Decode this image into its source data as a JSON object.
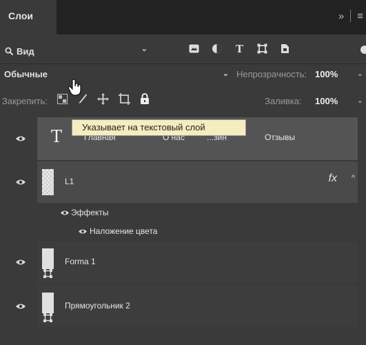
{
  "tabs": {
    "active_label": "Слои",
    "collapse_symbol": "»",
    "menu_symbol": "≡"
  },
  "filter": {
    "label": "Вид",
    "icons": [
      "pixel-filter-icon",
      "adjustment-filter-icon",
      "type-filter-icon",
      "shape-filter-icon",
      "smart-object-filter-icon"
    ],
    "type_icon_glyph": "T"
  },
  "blend": {
    "mode": "Обычные",
    "opacity_label": "Непрозрачность:",
    "opacity_value": "100%"
  },
  "lock": {
    "label": "Закрепить:",
    "fill_label": "Заливка:",
    "fill_value": "100%"
  },
  "layers": {
    "text_layer": {
      "glyph": "T",
      "tabs": [
        "Главная",
        "О нас",
        "...зин",
        "Отзывы"
      ]
    },
    "l1": {
      "name": "L1",
      "fx": "fx"
    },
    "effects_label": "Эффекты",
    "color_overlay_label": "Наложение цвета",
    "forma1": {
      "name": "Forma 1"
    },
    "rect2": {
      "name": "Прямоугольник 2"
    }
  },
  "tooltip": "Указывает на текстовый слой"
}
